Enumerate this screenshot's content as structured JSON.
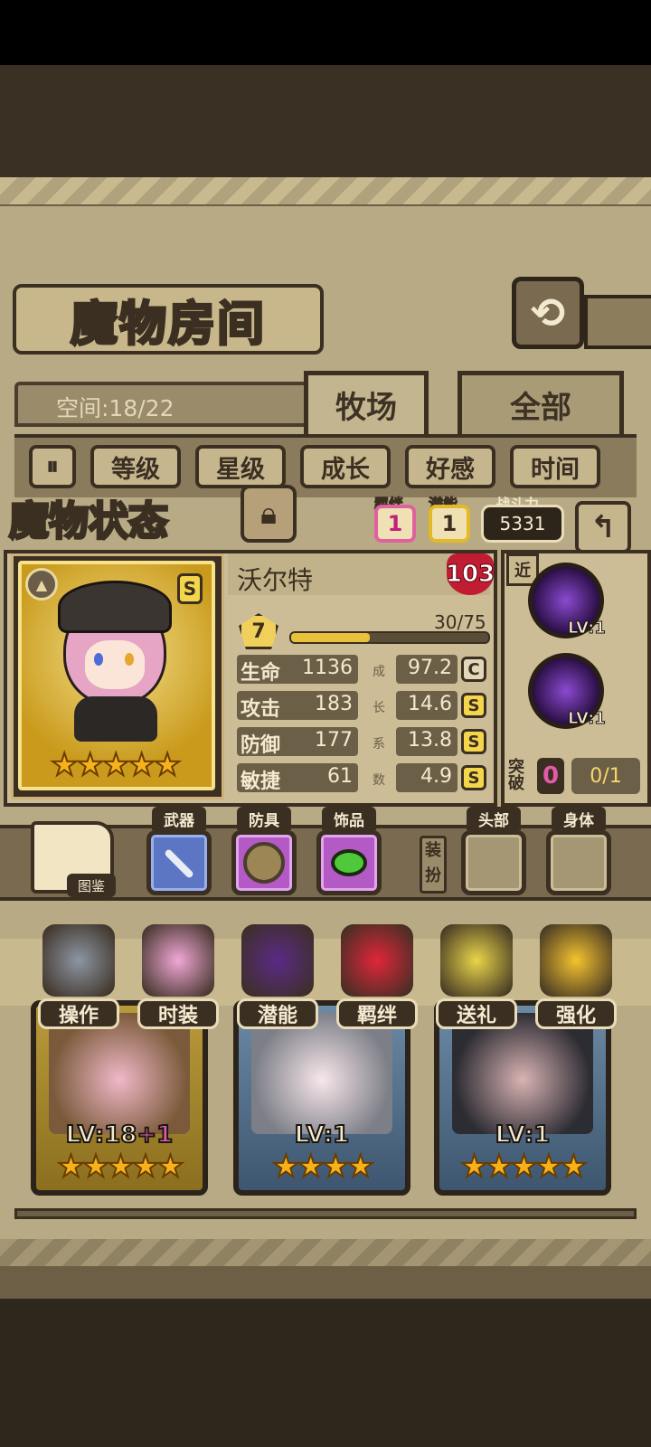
{
  "header": {
    "title": "魔物房间",
    "back_icon": "undo-arrow-icon"
  },
  "space": {
    "label": "空间:18/22"
  },
  "tabs": [
    {
      "label": "牧场",
      "active": true
    },
    {
      "label": "全部",
      "active": false
    }
  ],
  "filters": {
    "sort_icon": "sort-order-icon",
    "items": [
      "等级",
      "星级",
      "成长",
      "好感",
      "时间"
    ]
  },
  "status": {
    "title": "魔物状态",
    "bond_label": "羁绊",
    "bond_value": "1",
    "potential_label": "潜能",
    "potential_value": "1",
    "power_label": "战斗力",
    "power_value": "5331",
    "monster": {
      "name": "沃尔特",
      "affection": "103",
      "rank": "S",
      "level": "7",
      "xp_text": "30/75",
      "xp_fraction": 0.4,
      "stars": "★★★★★",
      "stats": [
        {
          "label": "生命",
          "value": "1136",
          "growth": "97.2",
          "grade": "C"
        },
        {
          "label": "攻击",
          "value": "183",
          "growth": "14.6",
          "grade": "S"
        },
        {
          "label": "防御",
          "value": "177",
          "growth": "13.8",
          "grade": "S"
        },
        {
          "label": "敏捷",
          "value": "61",
          "growth": "4.9",
          "grade": "S"
        }
      ],
      "growth_chars": [
        "成",
        "长",
        "系",
        "数"
      ]
    },
    "range": "近",
    "skills": [
      {
        "lv": "LV:1"
      },
      {
        "lv": "LV:1"
      }
    ],
    "breakthrough": {
      "label": "突破",
      "count": "0",
      "ratio": "0/1"
    }
  },
  "equipment": {
    "codex_label": "图鉴",
    "slots": [
      {
        "label": "武器"
      },
      {
        "label": "防具"
      },
      {
        "label": "饰品"
      }
    ],
    "dress_label": "装扮",
    "dress_slots": [
      {
        "label": "头部"
      },
      {
        "label": "身体"
      }
    ]
  },
  "actions": [
    {
      "label": "操作",
      "icon": "gear-icon"
    },
    {
      "label": "时装",
      "icon": "outfit-icon"
    },
    {
      "label": "潜能",
      "icon": "devil-icon"
    },
    {
      "label": "羁绊",
      "icon": "hearts-icon"
    },
    {
      "label": "送礼",
      "icon": "gift-icon"
    },
    {
      "label": "强化",
      "icon": "upgrade-arrows-icon"
    }
  ],
  "monsters": [
    {
      "lv": "LV:18",
      "plus": "+1",
      "stars": "★★★★★"
    },
    {
      "lv": "LV:1",
      "plus": "",
      "stars": "★★★★"
    },
    {
      "lv": "LV:1",
      "plus": "",
      "stars": "★★★★★"
    }
  ],
  "colors": {
    "gold": "#f4d64a",
    "pink": "#e060a0",
    "heart": "#c01c32",
    "skill": "#8b4ad1"
  }
}
